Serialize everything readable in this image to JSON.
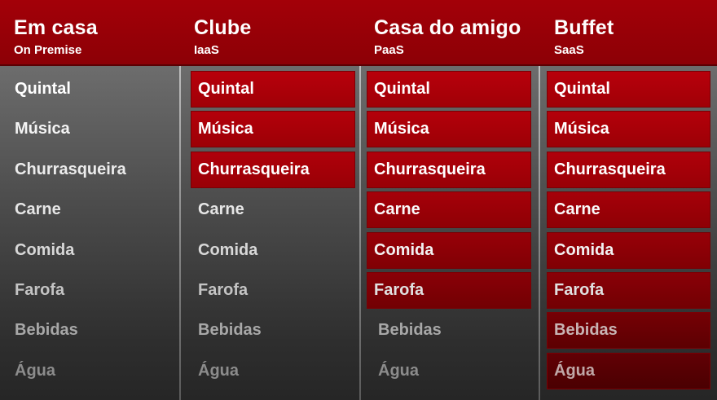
{
  "columns": [
    {
      "title": "Em casa",
      "subtitle": "On Premise",
      "items": [
        {
          "label": "Quintal",
          "managed": false
        },
        {
          "label": "Música",
          "managed": false
        },
        {
          "label": "Churrasqueira",
          "managed": false
        },
        {
          "label": "Carne",
          "managed": false
        },
        {
          "label": "Comida",
          "managed": false
        },
        {
          "label": "Farofa",
          "managed": false
        },
        {
          "label": "Bebidas",
          "managed": false
        },
        {
          "label": "Água",
          "managed": false
        }
      ]
    },
    {
      "title": "Clube",
      "subtitle": "IaaS",
      "items": [
        {
          "label": "Quintal",
          "managed": true
        },
        {
          "label": "Música",
          "managed": true
        },
        {
          "label": "Churrasqueira",
          "managed": true
        },
        {
          "label": "Carne",
          "managed": false
        },
        {
          "label": "Comida",
          "managed": false
        },
        {
          "label": "Farofa",
          "managed": false
        },
        {
          "label": "Bebidas",
          "managed": false
        },
        {
          "label": "Água",
          "managed": false
        }
      ]
    },
    {
      "title": "Casa do amigo",
      "subtitle": "PaaS",
      "items": [
        {
          "label": "Quintal",
          "managed": true
        },
        {
          "label": "Música",
          "managed": true
        },
        {
          "label": "Churrasqueira",
          "managed": true
        },
        {
          "label": "Carne",
          "managed": true
        },
        {
          "label": "Comida",
          "managed": true
        },
        {
          "label": "Farofa",
          "managed": true
        },
        {
          "label": "Bebidas",
          "managed": false
        },
        {
          "label": "Água",
          "managed": false
        }
      ]
    },
    {
      "title": "Buffet",
      "subtitle": "SaaS",
      "items": [
        {
          "label": "Quintal",
          "managed": true
        },
        {
          "label": "Música",
          "managed": true
        },
        {
          "label": "Churrasqueira",
          "managed": true
        },
        {
          "label": "Carne",
          "managed": true
        },
        {
          "label": "Comida",
          "managed": true
        },
        {
          "label": "Farofa",
          "managed": true
        },
        {
          "label": "Bebidas",
          "managed": true
        },
        {
          "label": "Água",
          "managed": true
        }
      ]
    }
  ],
  "colors": {
    "header_red": "#a30008",
    "box_red": "#b5000a",
    "text_white": "#ffffff"
  }
}
